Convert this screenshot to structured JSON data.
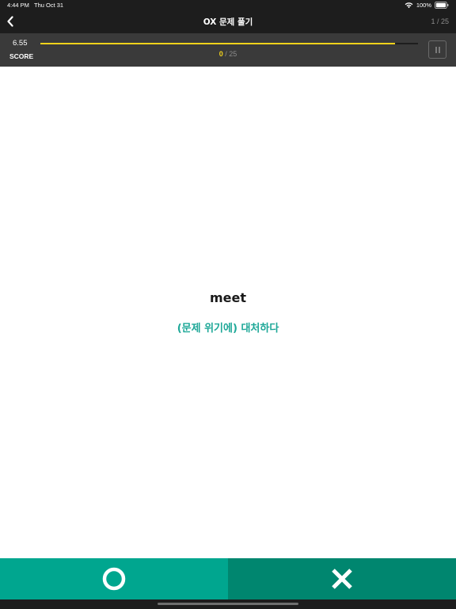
{
  "status_bar": {
    "time": "4:44 PM",
    "date": "Thu Oct 31",
    "battery": "100%"
  },
  "nav": {
    "title": "OX 문제 풀기",
    "page_counter": "1 / 25"
  },
  "score": {
    "value": "6.55",
    "label": "SCORE",
    "time_progress": 0.94
  },
  "progress": {
    "correct": "0",
    "separator_total": "/ 25"
  },
  "question": {
    "word": "meet",
    "meaning": "(문제 위기에) 대처하다"
  },
  "answers": {
    "o_icon": "circle-o-icon",
    "x_icon": "cross-x-icon"
  },
  "colors": {
    "accent_yellow": "#f2d21b",
    "o_button": "#00a68f",
    "x_button": "#00866f",
    "meaning_text": "#1ea898"
  }
}
